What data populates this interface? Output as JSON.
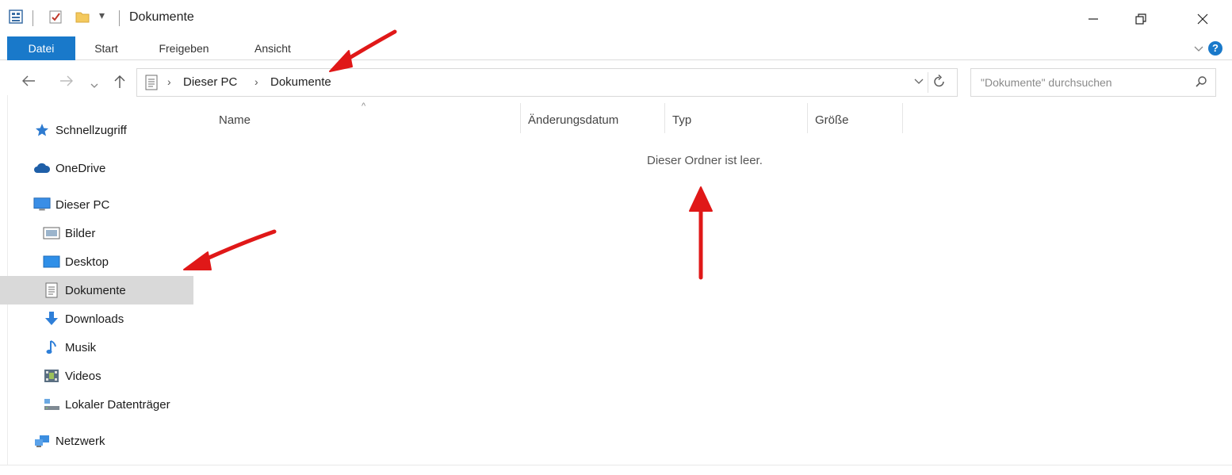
{
  "window": {
    "title": "Dokumente",
    "controls": {
      "minimize": "—",
      "maximize": "⧉",
      "close": "✕"
    }
  },
  "ribbon": {
    "tabs": [
      "Datei",
      "Start",
      "Freigeben",
      "Ansicht"
    ],
    "help": "?"
  },
  "address": {
    "breadcrumb": [
      "Dieser PC",
      "Dokumente"
    ],
    "search_placeholder": "\"Dokumente\" durchsuchen"
  },
  "sidebar": {
    "items": [
      {
        "label": "Schnellzugriff",
        "icon": "star-icon"
      },
      {
        "label": "OneDrive",
        "icon": "cloud-icon"
      },
      {
        "label": "Dieser PC",
        "icon": "computer-icon"
      },
      {
        "label": "Bilder",
        "icon": "pictures-icon"
      },
      {
        "label": "Desktop",
        "icon": "desktop-icon"
      },
      {
        "label": "Dokumente",
        "icon": "documents-icon",
        "selected": true
      },
      {
        "label": "Downloads",
        "icon": "download-icon"
      },
      {
        "label": "Musik",
        "icon": "music-icon"
      },
      {
        "label": "Videos",
        "icon": "videos-icon"
      },
      {
        "label": "Lokaler Datenträger",
        "icon": "drive-icon"
      },
      {
        "label": "Netzwerk",
        "icon": "network-icon"
      }
    ]
  },
  "columns": [
    "Name",
    "Änderungsdatum",
    "Typ",
    "Größe"
  ],
  "content": {
    "empty_message": "Dieser Ordner ist leer."
  },
  "colors": {
    "accent": "#1979ca",
    "selection": "#d9d9d9",
    "annotation": "#e01818"
  }
}
